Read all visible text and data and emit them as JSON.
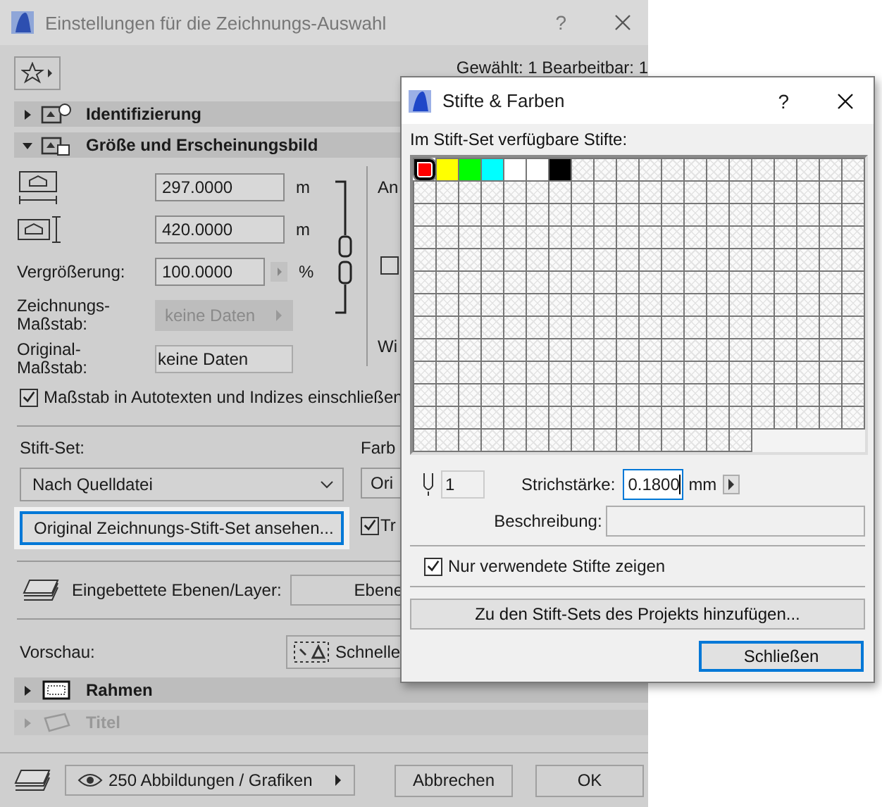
{
  "main_dialog": {
    "title": "Einstellungen für die Zeichnungs-Auswahl",
    "help": "?",
    "selection_info": "Gewählt: 1 Bearbeitbar: 1",
    "sections": [
      {
        "label": "Identifizierung",
        "expanded": false,
        "disabled": false
      },
      {
        "label": "Größe und Erscheinungsbild",
        "expanded": true,
        "disabled": false
      }
    ],
    "width": {
      "value": "297.0000",
      "unit": "m"
    },
    "height": {
      "value": "420.0000",
      "unit": "m"
    },
    "magnification": {
      "label": "Vergrößerung:",
      "value": "100.0000",
      "unit": "%"
    },
    "drawing_scale": {
      "label": "Zeichnungs-Maßstab:",
      "value": "keine Daten",
      "disabled": true
    },
    "original_scale": {
      "label": "Original-Maßstab:",
      "value": "keine Daten"
    },
    "column_2": {
      "label_1": "An",
      "checkbox_checked": false,
      "label_2": "Wi"
    },
    "scale_in_autotext": {
      "label": "Maßstab in Autotexten und Indizes einschließen",
      "checked": true
    },
    "pen_set": {
      "label": "Stift-Set:",
      "value": "Nach Quelldatei",
      "button": "Original Zeichnungs-Stift-Set ansehen..."
    },
    "column_3": {
      "label": "Farb",
      "value": "Ori",
      "checkbox_checked": true,
      "checkbox_label": "Tr"
    },
    "layers": {
      "label": "Eingebettete Ebenen/Layer:",
      "button": "Ebene"
    },
    "preview": {
      "label": "Vorschau:",
      "button": "Schnelle"
    },
    "lower_sections": [
      {
        "label": "Rahmen",
        "expanded": false,
        "disabled": false
      },
      {
        "label": "Titel",
        "expanded": false,
        "disabled": true
      }
    ],
    "footer": {
      "pictures": "250 Abbildungen / Grafiken",
      "buttons": [
        "Abbrechen",
        "OK"
      ]
    }
  },
  "pen_dialog": {
    "title": "Stifte & Farben",
    "help": "?",
    "grid_label": "Im Stift-Set verfügbare Stifte:",
    "pens": [
      {
        "color": "#ff0000",
        "selected": true
      },
      {
        "color": "#ffff00",
        "selected": false
      },
      {
        "color": "#00ff00",
        "selected": false
      },
      {
        "color": "#00ffff",
        "selected": false
      },
      {
        "color": "#ffffff",
        "selected": false
      },
      {
        "color": "#ffffff",
        "selected": false
      },
      {
        "color": "#000000",
        "selected": false
      }
    ],
    "pen_number": "1",
    "weight_label": "Strichstärke:",
    "weight": "0.1800",
    "weight_unit": "mm",
    "description_label": "Beschreibung:",
    "show_used_only": {
      "label": "Nur verwendete Stifte zeigen",
      "checked": true
    },
    "add_button": "Zu den Stift-Sets des Projekts hinzufügen...",
    "close_button": "Schließen"
  }
}
